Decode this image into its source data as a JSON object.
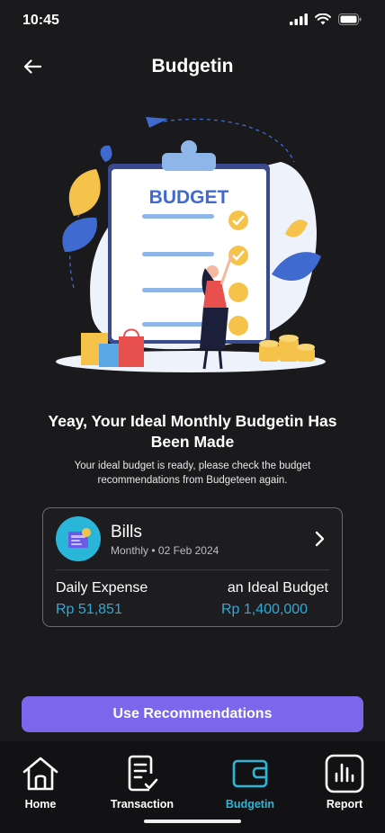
{
  "status_bar": {
    "time": "10:45"
  },
  "header": {
    "title": "Budgetin"
  },
  "illustration": {
    "board_text": "BUDGET"
  },
  "message": {
    "headline": "Yeay, Your Ideal Monthly Budgetin Has Been Made",
    "subtext": "Your  ideal budget is ready, please check the budget recommendations from Budgeteen again."
  },
  "card": {
    "title": "Bills",
    "period": "Monthly",
    "separator": "•",
    "date": "02 Feb 2024",
    "daily_label": "Daily Expense",
    "daily_value": "Rp 51,851",
    "ideal_label": "an Ideal Budget",
    "ideal_value": "Rp 1,400,000"
  },
  "primary_button": {
    "label": "Use Recommendations"
  },
  "nav": {
    "items": [
      {
        "label": "Home",
        "icon": "home-icon"
      },
      {
        "label": "Transaction",
        "icon": "transaction-icon"
      },
      {
        "label": "Budgetin",
        "icon": "wallet-icon",
        "active": true
      },
      {
        "label": "Report",
        "icon": "report-icon"
      }
    ]
  },
  "colors": {
    "background": "#1a1a1c",
    "accent_purple": "#7b66ec",
    "accent_cyan": "#2bb7d9",
    "value_blue": "#33a7d6"
  }
}
